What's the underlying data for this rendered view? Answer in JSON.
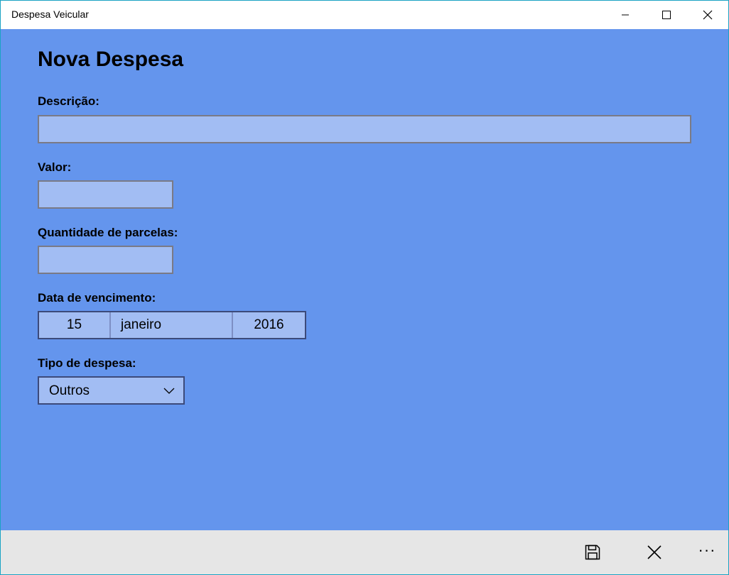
{
  "window": {
    "title": "Despesa Veicular"
  },
  "form": {
    "title": "Nova Despesa",
    "descricao": {
      "label": "Descrição:",
      "value": ""
    },
    "valor": {
      "label": "Valor:",
      "value": ""
    },
    "parcelas": {
      "label": "Quantidade de parcelas:",
      "value": ""
    },
    "vencimento": {
      "label": "Data de vencimento:",
      "day": "15",
      "month": "janeiro",
      "year": "2016"
    },
    "tipo": {
      "label": "Tipo de despesa:",
      "selected": "Outros"
    }
  },
  "appbar": {
    "more": "···",
    "icons": [
      "save-icon",
      "cancel-icon",
      "more-icon"
    ]
  },
  "colors": {
    "background": "#6495ed",
    "input_fill": "#a2bdf3",
    "appbar": "#e6e6e6",
    "window_border": "#1aa3c4"
  }
}
